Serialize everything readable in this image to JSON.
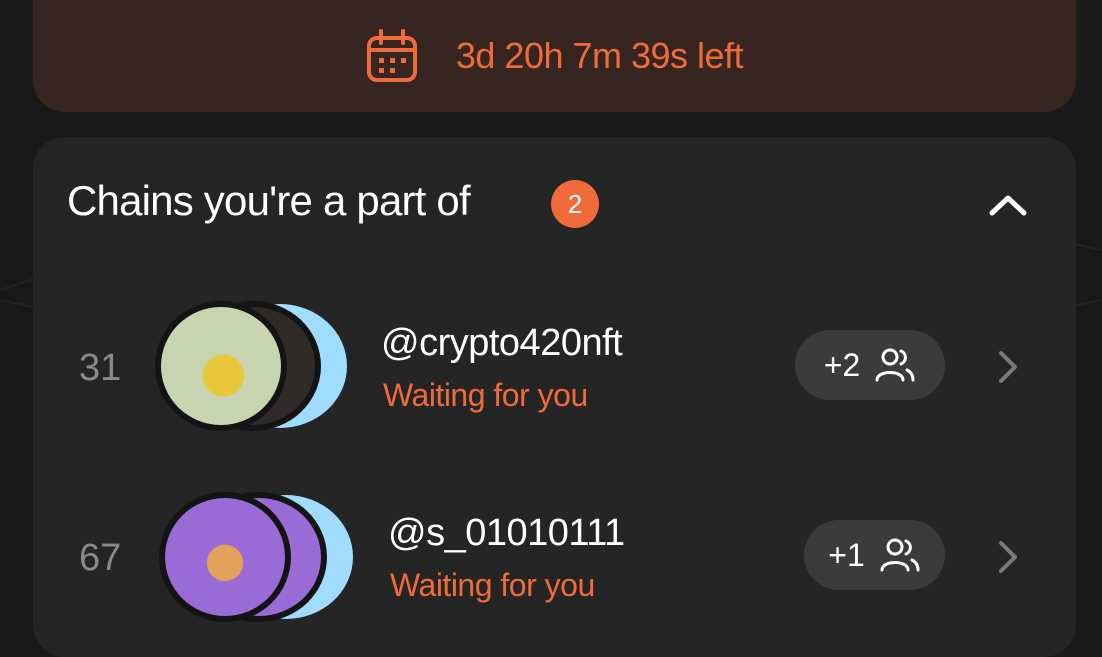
{
  "timer": {
    "icon": "calendar-icon",
    "text": "3d 20h 7m 39s left"
  },
  "chains": {
    "title": "Chains you're a part of",
    "count": "2",
    "collapse_icon": "chevron-up-icon",
    "items": [
      {
        "rank": "31",
        "handle": "@crypto420nft",
        "status": "Waiting for you",
        "extra_members": "+2",
        "members_icon": "people-icon",
        "chevron_icon": "chevron-right-icon"
      },
      {
        "rank": "67",
        "handle": "@s_01010111",
        "status": "Waiting for you",
        "extra_members": "+1",
        "members_icon": "people-icon",
        "chevron_icon": "chevron-right-icon"
      }
    ]
  },
  "colors": {
    "accent": "#f06b3a",
    "background": "#191919",
    "card": "#252525",
    "banner": "#362520",
    "pill": "#3b3b3b"
  }
}
